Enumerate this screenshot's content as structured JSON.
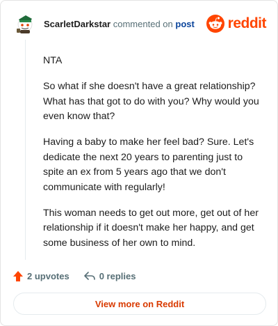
{
  "comment": {
    "username": "ScarletDarkstar",
    "commented_text": "commented on",
    "post_link": "post",
    "paragraphs": [
      "NTA",
      "So what if she doesn't have a great relationship? What has that got to do with you? Why would you even know that?",
      "Having a baby to make her feel bad? Sure. Let's dedicate the next 20 years to parenting just to spite an ex from 5 years ago that we don't communicate with regularly!",
      "This woman needs to get out more, get out of her relationship if it doesn't make her happy, and get some business of her own to mind."
    ]
  },
  "brand": {
    "wordmark": "reddit",
    "icon": "reddit-snoo-icon",
    "color": "#ff4500"
  },
  "actions": {
    "upvotes_label": "2 upvotes",
    "upvote_icon": "upvote-arrow-icon",
    "upvote_color": "#ff4500",
    "replies_label": "0 replies",
    "reply_icon": "reply-arrow-icon"
  },
  "footer": {
    "view_more_label": "View more on Reddit",
    "accent": "#d93a00"
  }
}
